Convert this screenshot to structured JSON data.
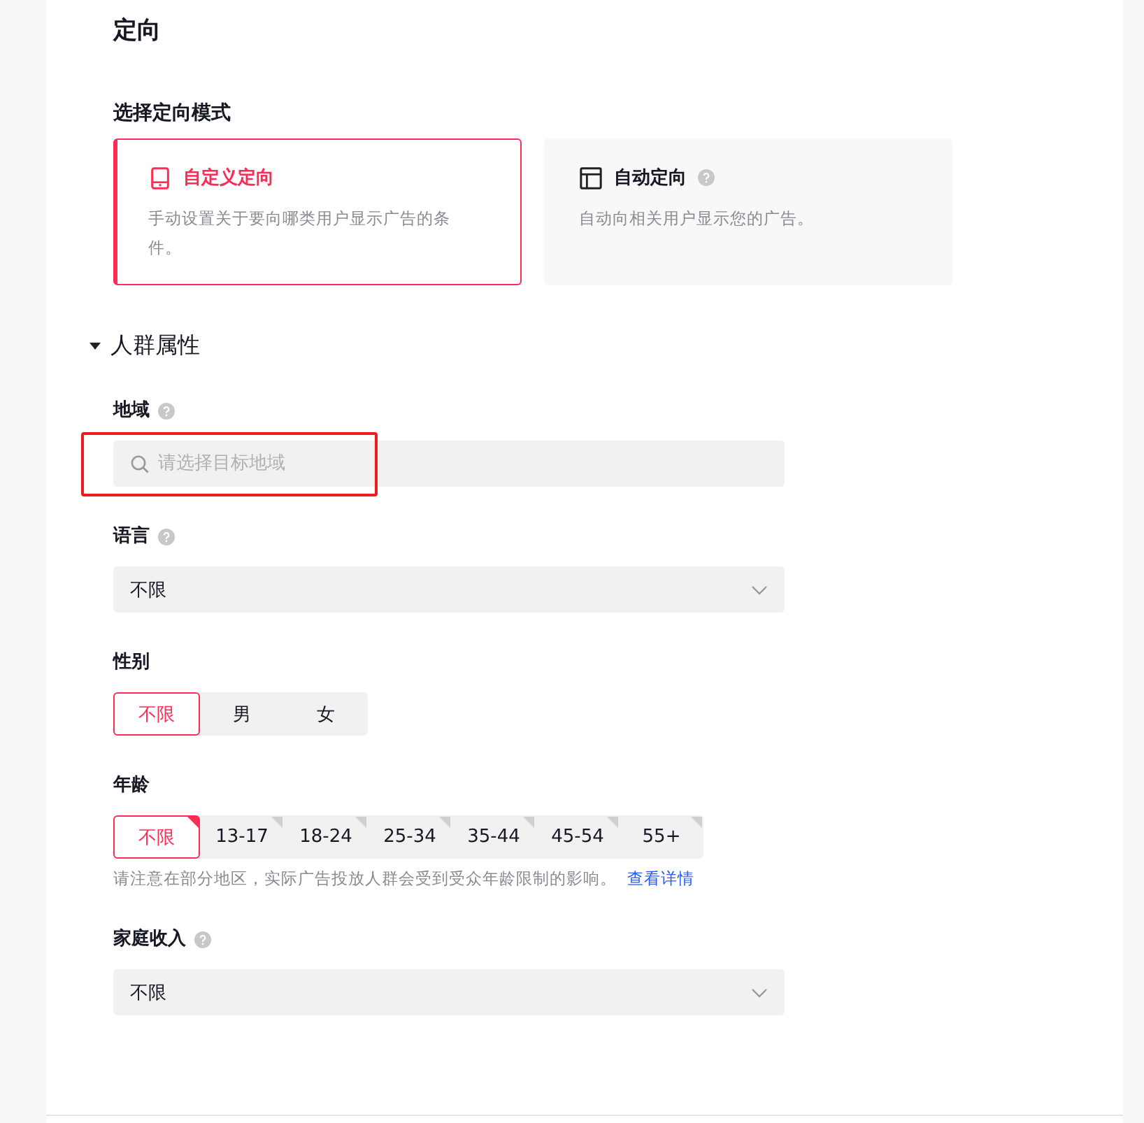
{
  "section_title": "定向",
  "mode": {
    "label": "选择定向模式",
    "options": [
      {
        "kind": "custom",
        "title": "自定义定向",
        "description": "手动设置关于要向哪类用户显示广告的条件。",
        "selected": true,
        "help": false
      },
      {
        "kind": "automatic",
        "title": "自动定向",
        "description": "自动向相关用户显示您的广告。",
        "selected": false,
        "help": true
      }
    ]
  },
  "group": {
    "title": "人群属性",
    "expanded": true
  },
  "fields": [
    {
      "kind": "search",
      "label": "地域",
      "help": true,
      "placeholder": "请选择目标地域",
      "highlighted": true
    },
    {
      "kind": "select",
      "label": "语言",
      "help": true,
      "value": "不限"
    },
    {
      "kind": "segmented",
      "label": "性别",
      "help": false,
      "corner_marks": false,
      "options": [
        {
          "label": "不限",
          "selected": true
        },
        {
          "label": "男",
          "selected": false
        },
        {
          "label": "女",
          "selected": false
        }
      ]
    },
    {
      "kind": "segmented",
      "label": "年龄",
      "help": false,
      "corner_marks": true,
      "options": [
        {
          "label": "不限",
          "selected": true
        },
        {
          "label": "13-17",
          "selected": false
        },
        {
          "label": "18-24",
          "selected": false
        },
        {
          "label": "25-34",
          "selected": false
        },
        {
          "label": "35-44",
          "selected": false
        },
        {
          "label": "45-54",
          "selected": false
        },
        {
          "label": "55+",
          "selected": false
        }
      ],
      "note": "请注意在部分地区，实际广告投放人群会受到受众年龄限制的影响。",
      "note_link": "查看详情"
    },
    {
      "kind": "select",
      "label": "家庭收入",
      "help": true,
      "value": "不限"
    }
  ]
}
